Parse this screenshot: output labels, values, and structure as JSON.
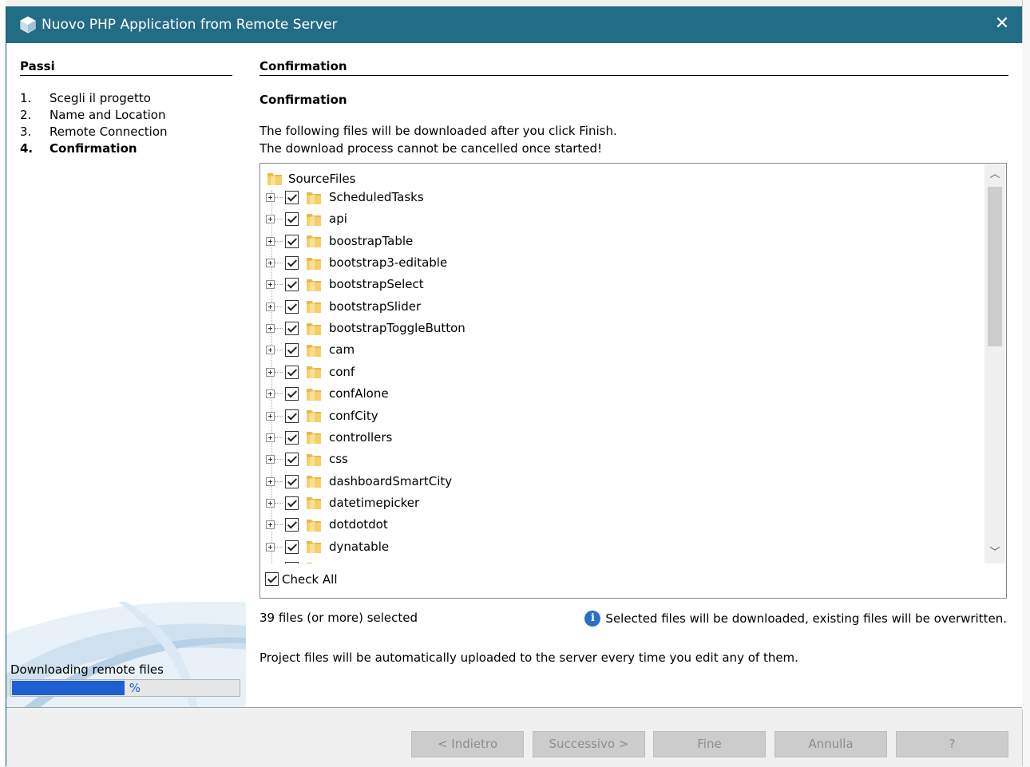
{
  "window": {
    "title": "Nuovo PHP Application from Remote Server",
    "close_glyph": "✕"
  },
  "steps": {
    "heading": "Passi",
    "items": [
      {
        "num": "1.",
        "label": "Scegli il progetto"
      },
      {
        "num": "2.",
        "label": "Name and Location"
      },
      {
        "num": "3.",
        "label": "Remote Connection"
      },
      {
        "num": "4.",
        "label": "Confirmation"
      }
    ],
    "download_label": "Downloading remote files",
    "progress_fraction": 0.5,
    "progress_text": "50 %"
  },
  "content": {
    "heading": "Confirmation",
    "sub_heading": "Confirmation",
    "desc_line1": "The following files will be downloaded after you click Finish.",
    "desc_line2": "The download process cannot be cancelled once started!",
    "tree": {
      "root": "SourceFiles",
      "items": [
        "ScheduledTasks",
        "api",
        "boostrapTable",
        "bootstrap3-editable",
        "bootstrapSelect",
        "bootstrapSlider",
        "bootstrapToggleButton",
        "cam",
        "conf",
        "confAlone",
        "confCity",
        "controllers",
        "css",
        "dashboardSmartCity",
        "datetimepicker",
        "dotdotdot",
        "dynatable"
      ]
    },
    "check_all": "Check All",
    "selected_count": "39 files (or more) selected",
    "info_text": "Selected files will be downloaded, existing files will be overwritten.",
    "note": "Project files will be automatically uploaded to the server every time you edit any of them."
  },
  "buttons": {
    "back": "< Indietro",
    "next": "Successivo >",
    "finish": "Fine",
    "cancel": "Annulla",
    "help": "?"
  },
  "colors": {
    "titlebar": "#236c85",
    "progress": "#1f5fd0",
    "folder": "#f3c658"
  }
}
